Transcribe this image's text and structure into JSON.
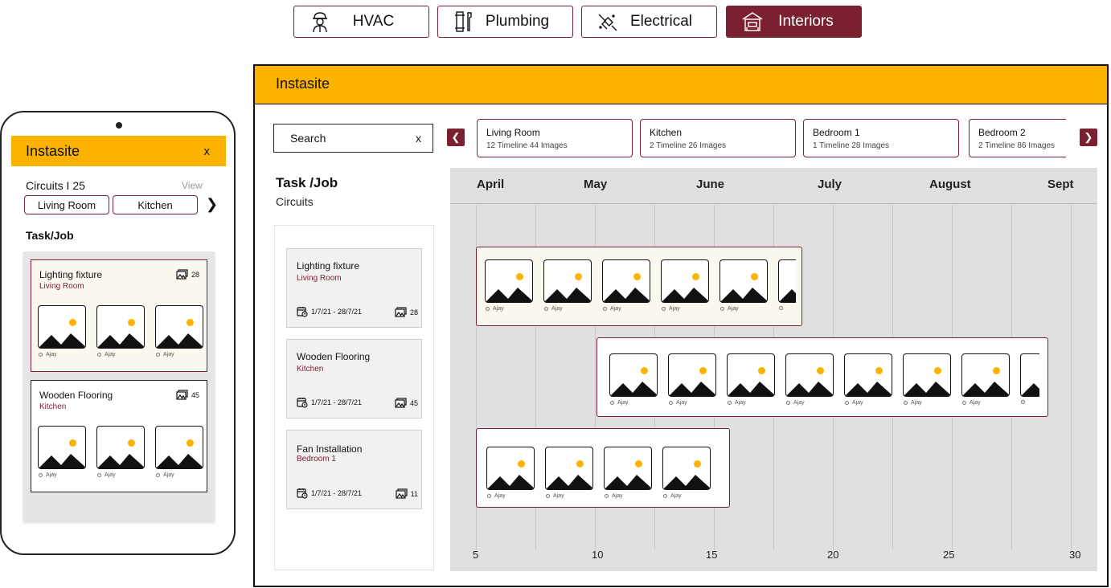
{
  "categories": [
    {
      "label": "HVAC",
      "icon": "worker-icon",
      "active": false
    },
    {
      "label": "Plumbing",
      "icon": "pipe-wrench-icon",
      "active": false
    },
    {
      "label": "Electrical",
      "icon": "wire-plug-icon",
      "active": false
    },
    {
      "label": "Interiors",
      "icon": "house-interior-icon",
      "active": true
    }
  ],
  "mobile": {
    "app_title": "Instasite",
    "close": "x",
    "circuits": "Circuits I 25",
    "view": "View",
    "chips": [
      "Living Room",
      "Kitchen"
    ],
    "task_heading": "Task/Job",
    "cards": [
      {
        "title": "Lighting fixture",
        "room": "Living Room",
        "count": "28",
        "authors": [
          "Ajay",
          "Ajay",
          "Ajay"
        ]
      },
      {
        "title": "Wooden Flooring",
        "room": "Kitchen",
        "count": "45",
        "authors": [
          "Ajay",
          "Ajay",
          "Ajay"
        ]
      }
    ]
  },
  "desktop": {
    "app_title": "Instasite",
    "search": {
      "label": "Search",
      "clear": "x"
    },
    "rooms": [
      {
        "name": "Living Room",
        "summary": "12 Timeline 44 Images"
      },
      {
        "name": "Kitchen",
        "summary": "2 Timeline 26 Images"
      },
      {
        "name": "Bedroom 1",
        "summary": "1 Timeline 28 Images"
      },
      {
        "name": "Bedroom 2",
        "summary": "2 Timeline 86 Images"
      }
    ],
    "task_heading": "Task /Job",
    "task_sub": "Circuits",
    "tasks": [
      {
        "title": "Lighting fixture",
        "room": "Living Room",
        "dates": "1/7/21 - 28/7/21",
        "count": "28"
      },
      {
        "title": "Wooden Flooring",
        "room": "Kitchen",
        "dates": "1/7/21 - 28/7/21",
        "count": "45"
      },
      {
        "title": "Fan Installation",
        "room": "Bedroom 1",
        "dates": "1/7/21 - 28/7/21",
        "count": "11"
      }
    ],
    "timeline": {
      "months": [
        "April",
        "May",
        "June",
        "July",
        "August",
        "Sept"
      ],
      "days": [
        "5",
        "10",
        "15",
        "20",
        "25",
        "30"
      ],
      "bars": [
        {
          "task": "Lighting fixture",
          "authors": [
            "Ajay",
            "Ajay",
            "Ajay",
            "Ajay",
            "Ajay",
            ""
          ]
        },
        {
          "task": "Wooden Flooring",
          "authors": [
            "Ajay",
            "Ajay",
            "Ajay",
            "Ajay",
            "Ajay",
            "Ajay",
            "Ajay",
            ""
          ]
        },
        {
          "task": "Fan Installation",
          "authors": [
            "Ajay",
            "Ajay",
            "Ajay",
            "Ajay"
          ]
        }
      ]
    }
  },
  "colors": {
    "accent": "#fbb300",
    "brand": "#7a2030",
    "timeline_bg": "#e0e0e0"
  }
}
